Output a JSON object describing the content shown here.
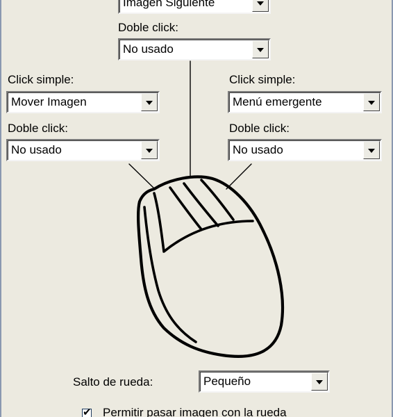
{
  "top_middle": {
    "single_value": "Imagen Siguiente",
    "double_label": "Doble click:",
    "double_value": "No usado"
  },
  "left_button": {
    "single_label": "Click simple:",
    "single_value": "Mover Imagen",
    "double_label": "Doble click:",
    "double_value": "No usado"
  },
  "right_button": {
    "single_label": "Click simple:",
    "single_value": "Menú emergente",
    "double_label": "Doble click:",
    "double_value": "No usado"
  },
  "wheel": {
    "label": "Salto de rueda:",
    "value": "Pequeño"
  },
  "wheel_scroll_checkbox": {
    "label": "Permitir pasar imagen con la rueda",
    "checked": true,
    "mark": "✔"
  },
  "icons": {
    "dropdown": "chevron-down-icon",
    "mouse": "mouse-illustration-icon",
    "check": "checkmark-icon"
  }
}
